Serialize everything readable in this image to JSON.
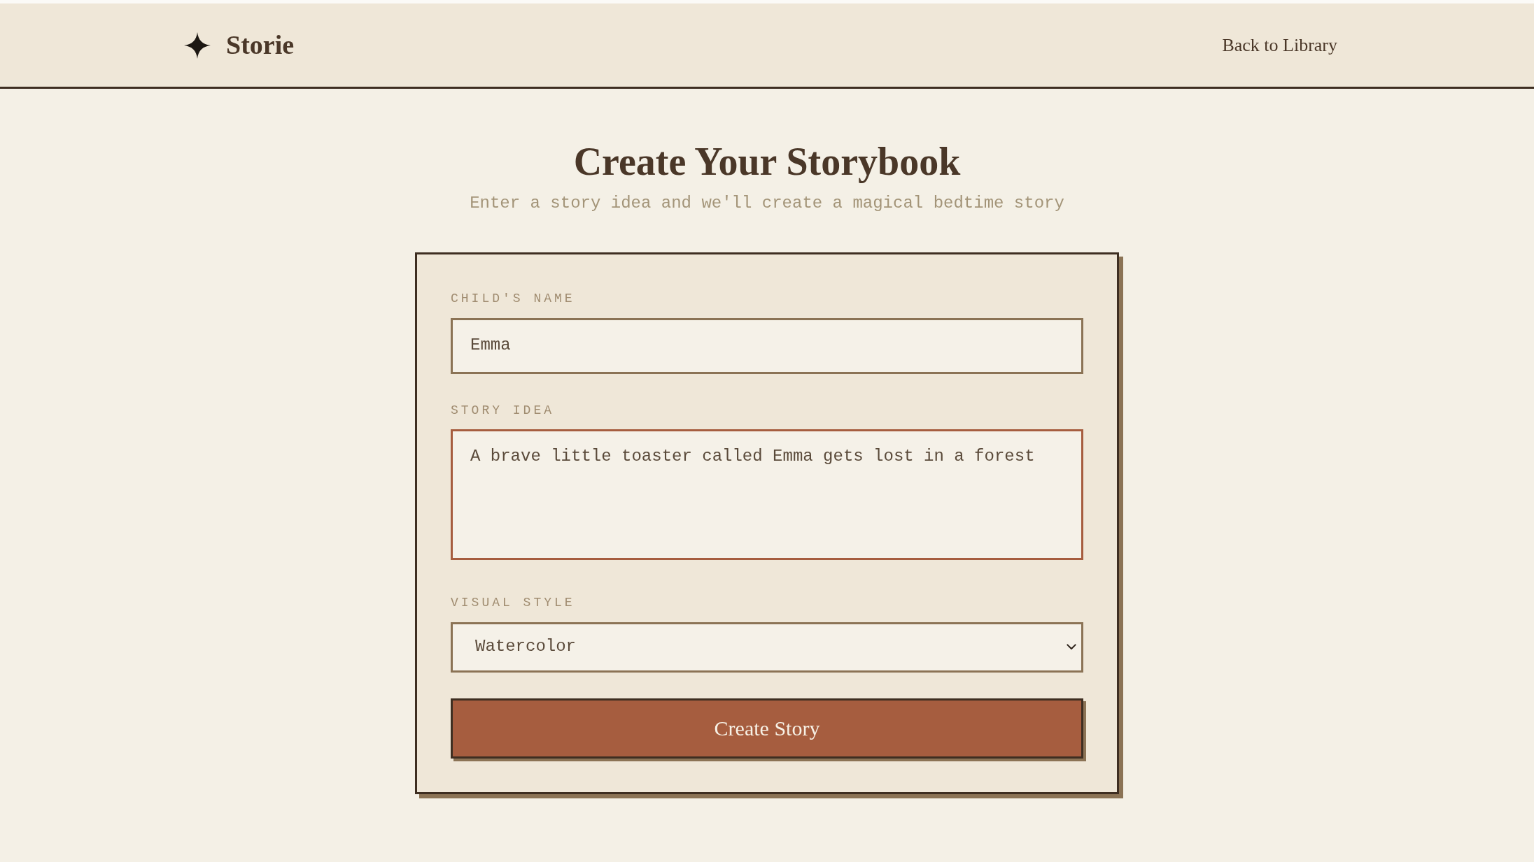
{
  "header": {
    "logo_text": "Storie",
    "nav_link": "Back to Library"
  },
  "page": {
    "title": "Create Your Storybook",
    "subtitle": "Enter a story idea and we'll create a magical bedtime story"
  },
  "form": {
    "fields": [
      {
        "kind": "text",
        "label": "CHILD'S NAME",
        "value": "Emma",
        "focused": false
      },
      {
        "kind": "textarea",
        "label": "STORY IDEA",
        "value": "A brave little toaster called Emma gets lost in a forest",
        "focused": true
      },
      {
        "kind": "select",
        "label": "VISUAL STYLE",
        "value": "Watercolor",
        "focused": false
      }
    ],
    "submit_button": "Create Story"
  }
}
